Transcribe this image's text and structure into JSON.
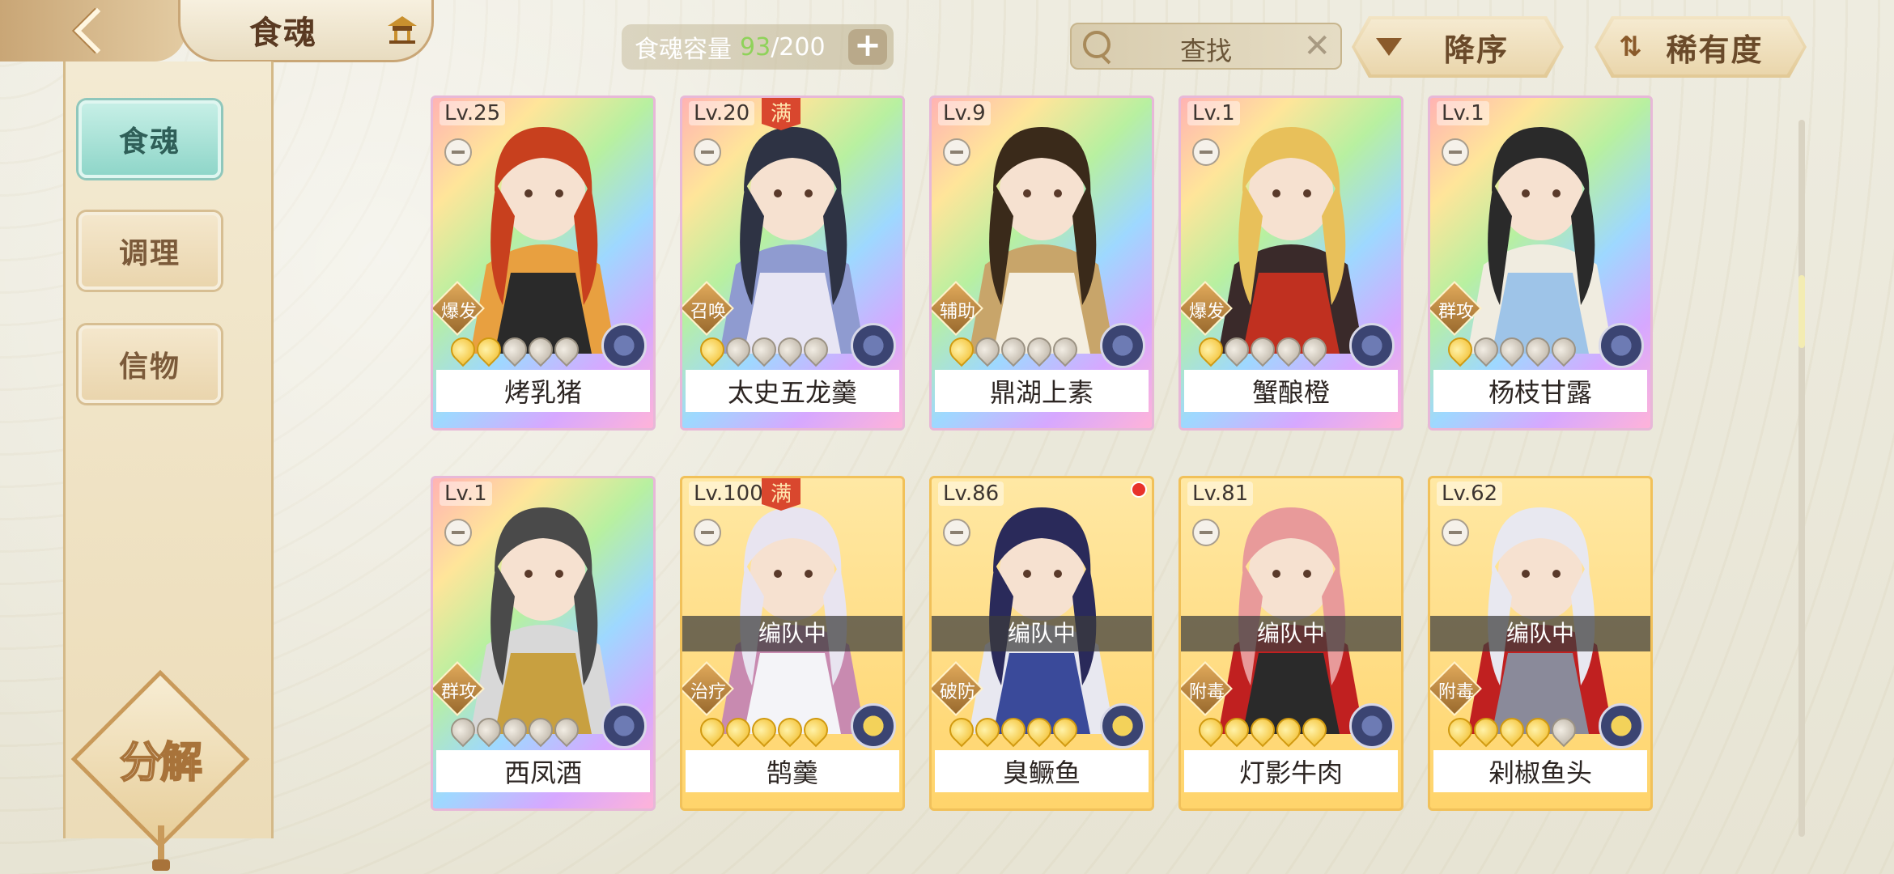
{
  "header": {
    "title": "食魂",
    "capacity_label": "食魂容量",
    "capacity_current": "93",
    "capacity_sep": "/",
    "capacity_max": "200",
    "add_label": "+",
    "search_placeholder": "查找",
    "clear_label": "✕",
    "sort_order_label": "降序",
    "sort_by_label": "稀有度"
  },
  "sidebar": {
    "tabs": [
      {
        "label": "食魂",
        "active": true
      },
      {
        "label": "调理",
        "active": false
      },
      {
        "label": "信物",
        "active": false
      }
    ],
    "decompose_label": "分解"
  },
  "cards": [
    {
      "level": "Lv.25",
      "name": "烤乳猪",
      "role": "爆发",
      "stars": 2,
      "frame": "rainbow",
      "maxed": false,
      "in_team": false,
      "element": "blue",
      "palette": [
        "#c8401e",
        "#e8a040",
        "#2a2a2a"
      ]
    },
    {
      "level": "Lv.20",
      "name": "太史五龙羹",
      "role": "召唤",
      "stars": 1,
      "frame": "rainbow",
      "maxed": true,
      "in_team": false,
      "element": "blue",
      "palette": [
        "#2e3344",
        "#8f9bd0",
        "#e8e6f4"
      ]
    },
    {
      "level": "Lv.9",
      "name": "鼎湖上素",
      "role": "辅助",
      "stars": 1,
      "frame": "rainbow",
      "maxed": false,
      "in_team": false,
      "element": "blue",
      "palette": [
        "#3a2a1a",
        "#c8a56a",
        "#f4eee0"
      ]
    },
    {
      "level": "Lv.1",
      "name": "蟹酿橙",
      "role": "爆发",
      "stars": 1,
      "frame": "rainbow",
      "maxed": false,
      "in_team": false,
      "element": "blue",
      "palette": [
        "#e8c05a",
        "#3a2a2a",
        "#c03020"
      ]
    },
    {
      "level": "Lv.1",
      "name": "杨枝甘露",
      "role": "群攻",
      "stars": 1,
      "frame": "rainbow",
      "maxed": false,
      "in_team": false,
      "element": "blue",
      "palette": [
        "#2a2a2a",
        "#f0ece0",
        "#9ec4e8"
      ]
    },
    {
      "level": "Lv.1",
      "name": "西凤酒",
      "role": "群攻",
      "stars": 0,
      "frame": "rainbow",
      "maxed": false,
      "in_team": false,
      "element": "blue",
      "palette": [
        "#4a4a4a",
        "#d8d8d8",
        "#c8a040"
      ]
    },
    {
      "level": "Lv.100",
      "name": "鹄羹",
      "role": "治疗",
      "stars": 5,
      "frame": "gold",
      "maxed": true,
      "in_team": true,
      "element": "gold",
      "palette": [
        "#e8e4f0",
        "#c88ab0",
        "#f4f4f8"
      ]
    },
    {
      "level": "Lv.86",
      "name": "臭鳜鱼",
      "role": "破防",
      "stars": 5,
      "frame": "gold",
      "maxed": false,
      "in_team": true,
      "element": "gold",
      "palette": [
        "#2a2a5a",
        "#e8e8f0",
        "#3a4a9a"
      ],
      "alert": true
    },
    {
      "level": "Lv.81",
      "name": "灯影牛肉",
      "role": "附毒",
      "stars": 5,
      "frame": "gold",
      "maxed": false,
      "in_team": true,
      "element": "blue",
      "palette": [
        "#e89a9a",
        "#c02020",
        "#2a2a2a"
      ]
    },
    {
      "level": "Lv.62",
      "name": "剁椒鱼头",
      "role": "附毒",
      "stars": 4,
      "frame": "gold",
      "maxed": false,
      "in_team": true,
      "element": "gold",
      "palette": [
        "#e8e8f0",
        "#c02020",
        "#8a8a9a"
      ]
    }
  ],
  "team_label": "编队中",
  "maxed_label": "满"
}
